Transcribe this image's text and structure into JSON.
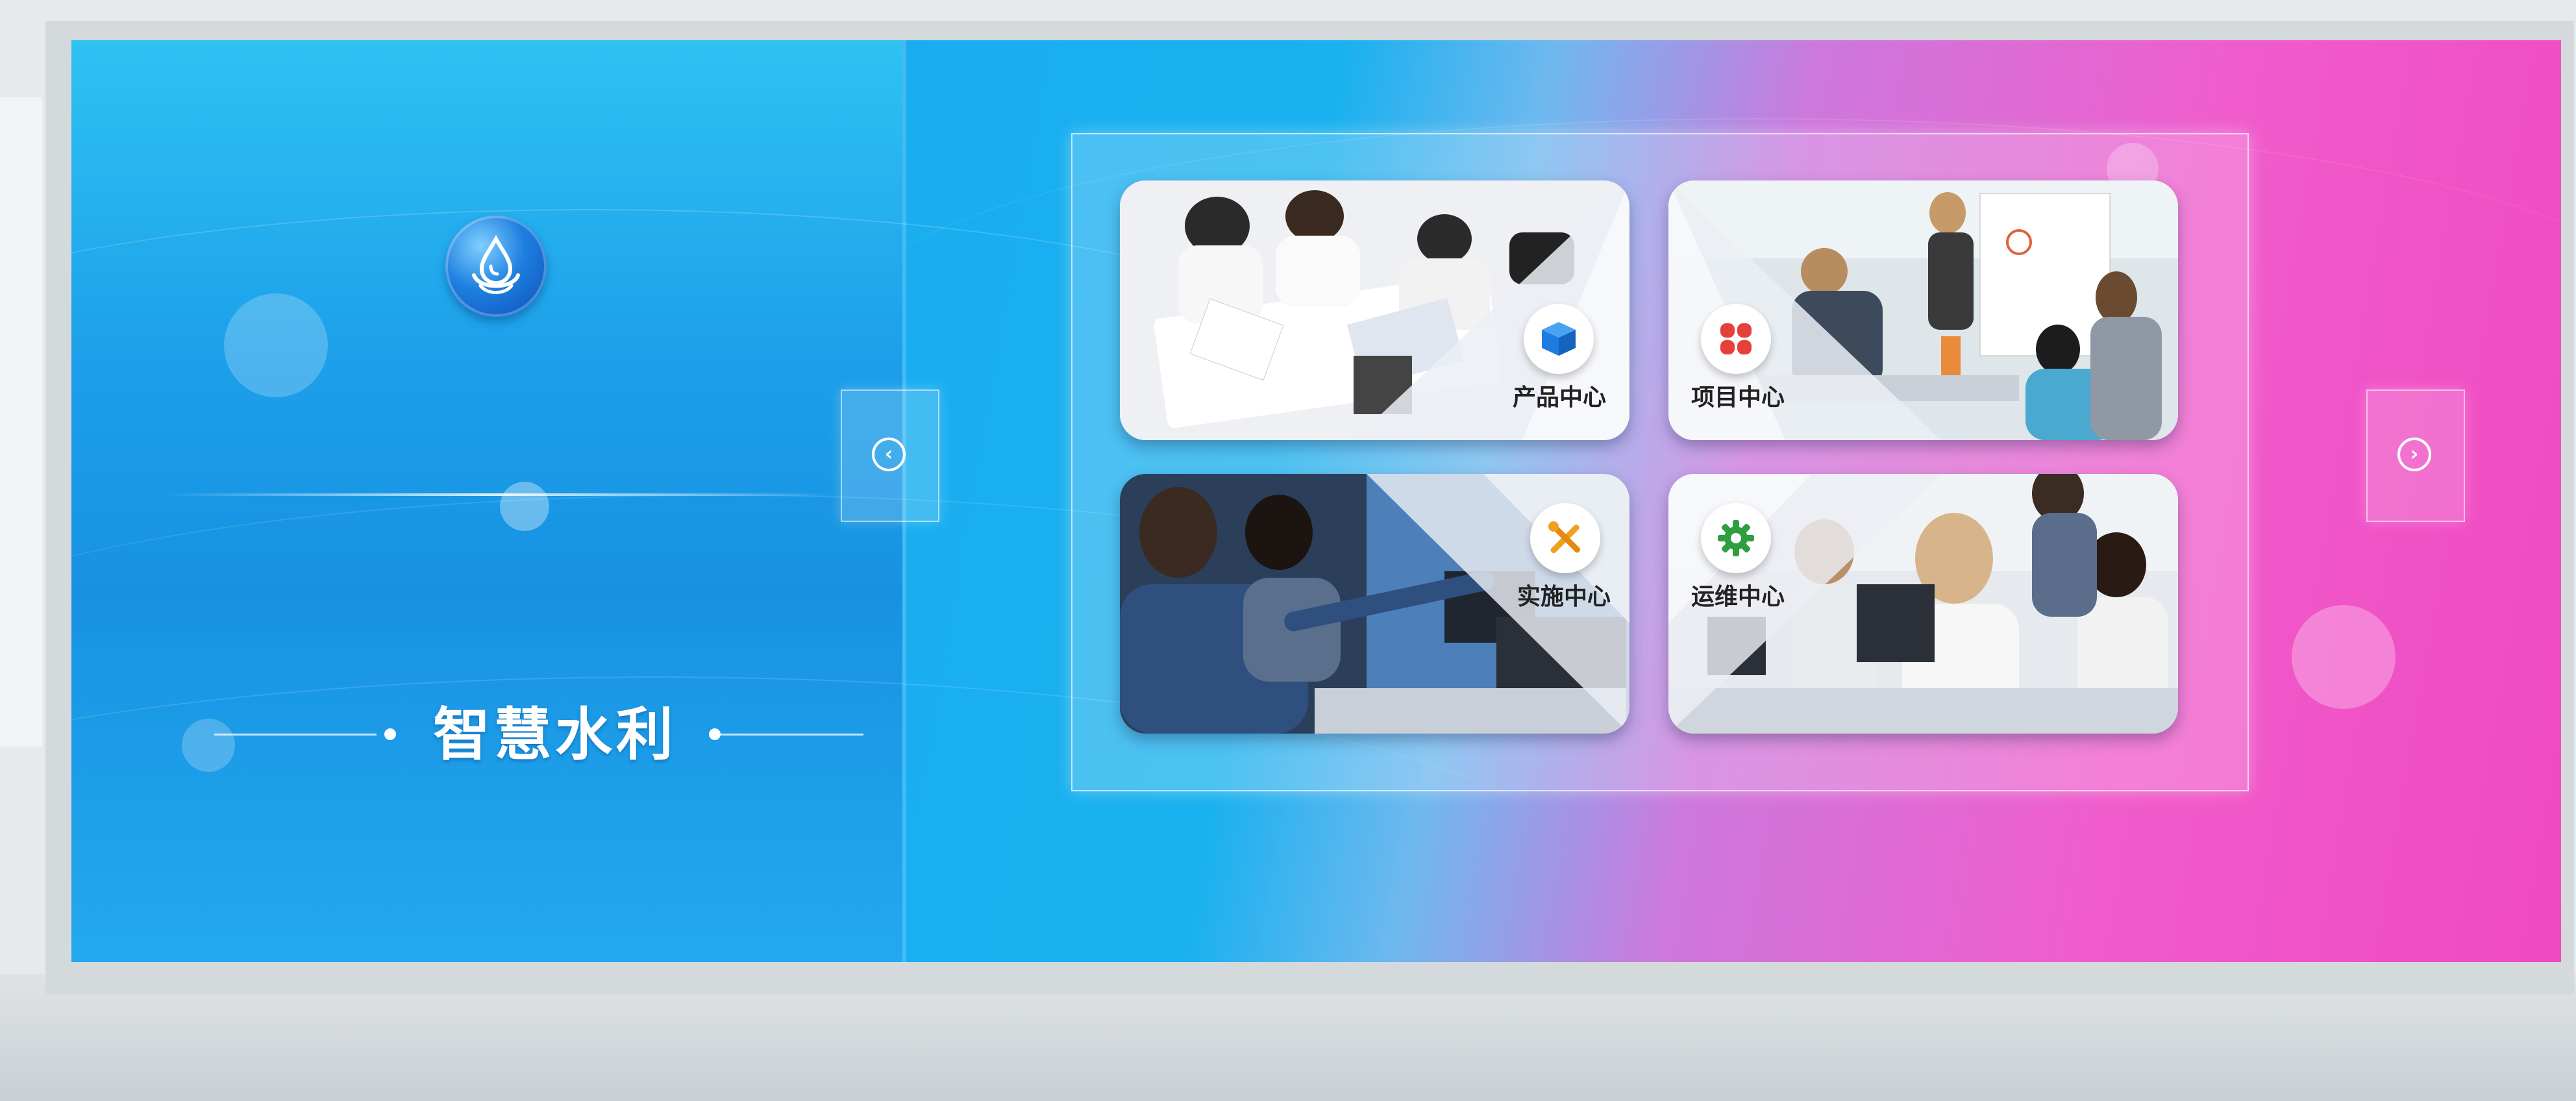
{
  "brand": {
    "logo_icon": "water-drop-icon",
    "title": "智慧水利"
  },
  "navigation": {
    "prev_icon": "chevron-left-icon",
    "next_icon": "chevron-right-icon",
    "prev_glyph": "‹",
    "next_glyph": "›"
  },
  "cards": [
    {
      "label": "产品中心",
      "icon": "cube-icon",
      "icon_color": "#1e7be0"
    },
    {
      "label": "项目中心",
      "icon": "clover-grid-icon",
      "icon_color": "#e5403c"
    },
    {
      "label": "实施中心",
      "icon": "tools-icon",
      "icon_color": "#f0a020"
    },
    {
      "label": "运维中心",
      "icon": "gear-icon",
      "icon_color": "#2e9e3e"
    }
  ],
  "colors": {
    "left_panel": "#1c9fea",
    "gradient_mid": "#6fb8ef",
    "gradient_right": "#f049c0"
  }
}
